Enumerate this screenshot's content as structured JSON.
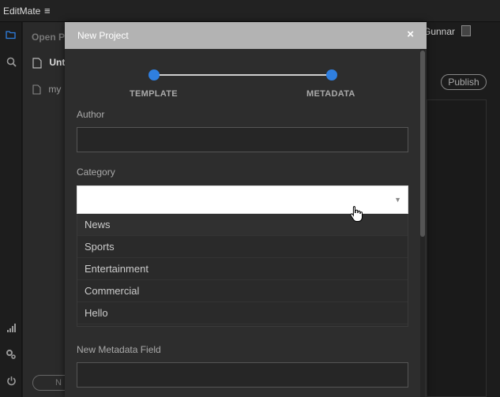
{
  "app": {
    "title": "EditMate",
    "menu_icon": "≡"
  },
  "rail": {
    "icons": [
      "folder-icon",
      "search-icon",
      "signal-icon",
      "settings-icon",
      "power-icon"
    ]
  },
  "panel": {
    "open_label": "Open P",
    "items": [
      {
        "label": "Unt",
        "icon": "document-edit-icon"
      },
      {
        "label": "my",
        "icon": "document-icon"
      }
    ],
    "new_button_label": "N"
  },
  "header": {
    "user_name": "Gunnar"
  },
  "right": {
    "publish_label": "Publish"
  },
  "modal": {
    "title": "New Project",
    "close_label": "×",
    "steps": [
      {
        "label": "TEMPLATE",
        "active": true
      },
      {
        "label": "METADATA",
        "active": true
      }
    ],
    "fields": {
      "author_label": "Author",
      "author_value": "",
      "category_label": "Category",
      "category_value": "",
      "new_field_label": "New Metadata Field",
      "new_field_value": ""
    },
    "category_options": [
      "News",
      "Sports",
      "Entertainment",
      "Commercial",
      "Hello"
    ]
  },
  "colors": {
    "accent": "#2f7fe0",
    "header": "#b3b3b3"
  }
}
